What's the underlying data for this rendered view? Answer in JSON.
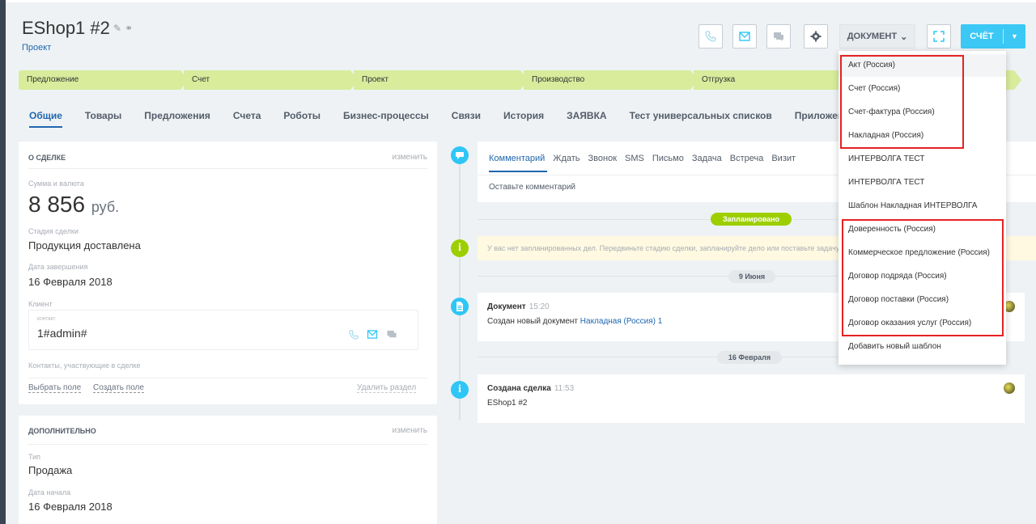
{
  "header": {
    "title": "EShop1 #2",
    "subtitle": "Проект",
    "document_button": "ДОКУМЕНТ",
    "save_button": "СЧЁТ"
  },
  "stages": [
    "Предложение",
    "Счет",
    "Проект",
    "Производство",
    "Отгрузка"
  ],
  "tabs": [
    "Общие",
    "Товары",
    "Предложения",
    "Счета",
    "Роботы",
    "Бизнес-процессы",
    "Связи",
    "История",
    "ЗАЯВКА",
    "Тест универсальных списков",
    "Приложения"
  ],
  "deal_card": {
    "title": "О СДЕЛКЕ",
    "edit": "изменить",
    "amount_label": "Сумма и валюта",
    "amount": "8 856",
    "currency": "руб.",
    "stage_label": "Стадия сделки",
    "stage_value": "Продукция доставлена",
    "close_date_label": "Дата завершения",
    "close_date": "16 Февраля 2018",
    "client_label": "Клиент",
    "contact_label": "КОНТАКТ",
    "contact_name": "1#admin#",
    "participants_label": "Контакты, участвующие в сделке",
    "select_field": "Выбрать поле",
    "create_field": "Создать поле",
    "delete_section": "Удалить раздел"
  },
  "extra_card": {
    "title": "ДОПОЛНИТЕЛЬНО",
    "edit": "изменить",
    "type_label": "Тип",
    "type_value": "Продажа",
    "start_date_label": "Дата начала",
    "start_date": "16 Февраля 2018"
  },
  "timeline": {
    "composer_tabs": [
      "Комментарий",
      "Ждать",
      "Звонок",
      "SMS",
      "Письмо",
      "Задача",
      "Встреча",
      "Визит"
    ],
    "placeholder": "Оставьте комментарий",
    "planned_badge": "Запланировано",
    "planned_text": "У вас нет запланированных дел. Передвиньте стадию сделки, запланируйте дело или поставьте задачу",
    "date1": "9 Июня",
    "doc_title": "Документ",
    "doc_time": "15:20",
    "doc_text": "Создан новый документ",
    "doc_link": "Накладная (Россия) 1",
    "date2": "16 Февраля",
    "created_title": "Создана сделка",
    "created_time": "11:53",
    "created_text": "EShop1 #2"
  },
  "dropdown": {
    "items": [
      "Акт (Россия)",
      "Счет (Россия)",
      "Счет-фактура (Россия)",
      "Накладная (Россия)",
      "ИНТЕРВОЛГА ТЕСТ",
      "ИНТЕРВОЛГА ТЕСТ",
      "Шаблон Накладная ИНТЕРВОЛГА",
      "Доверенность (Россия)",
      "Коммерческое предложение (Россия)",
      "Договор подряда (Россия)",
      "Договор поставки (Россия)",
      "Договор оказания услуг (Россия)",
      "Добавить новый шаблон"
    ]
  },
  "colors": {
    "accent": "#2067b0",
    "stage": "#d8ec9c",
    "highlight": "#e52222",
    "save": "#3bc8f5",
    "badge_green": "#9dcf00"
  }
}
